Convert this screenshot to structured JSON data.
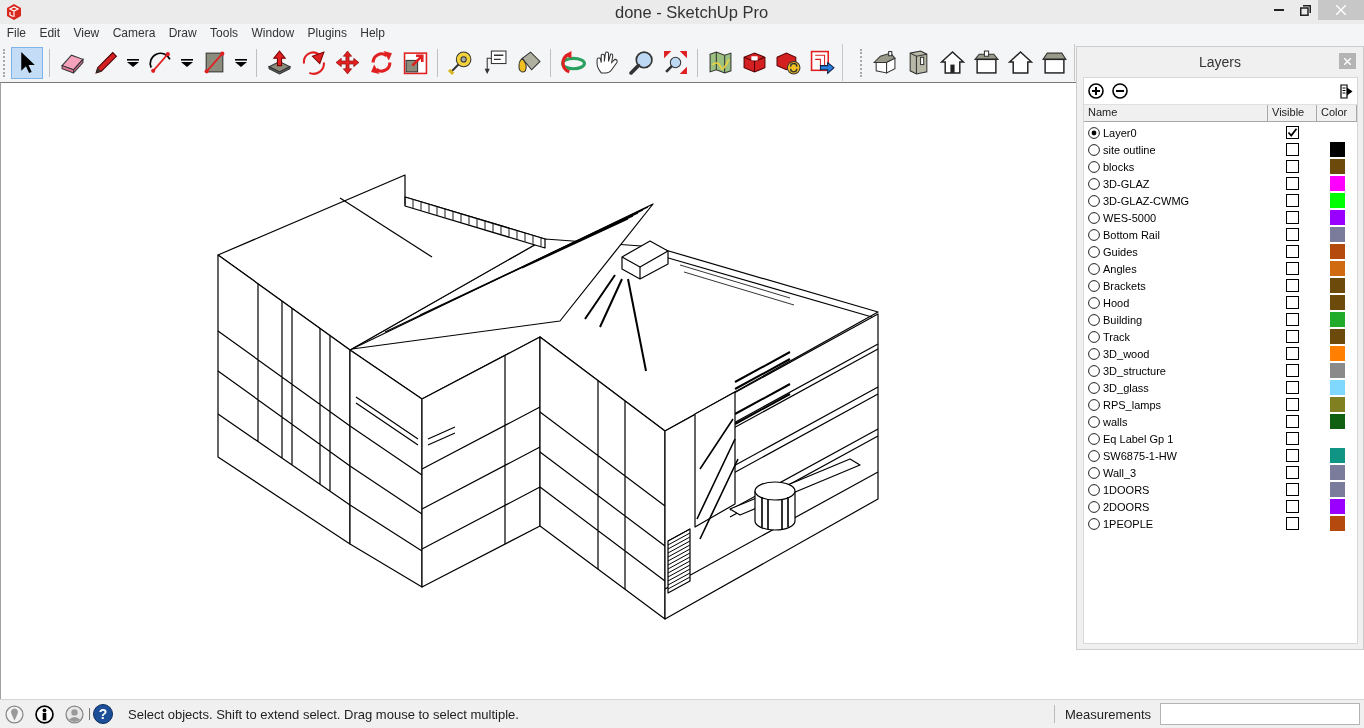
{
  "window": {
    "title": "done - SketchUp Pro"
  },
  "menu": [
    "File",
    "Edit",
    "View",
    "Camera",
    "Draw",
    "Tools",
    "Window",
    "Plugins",
    "Help"
  ],
  "toolbars": [
    {
      "groups": [
        [
          {
            "kind": "select",
            "selected": true,
            "dropdown": false
          }
        ],
        [
          {
            "kind": "eraser",
            "selected": false,
            "dropdown": false
          },
          {
            "kind": "pencil",
            "selected": false,
            "dropdown": true
          },
          {
            "kind": "arc",
            "selected": false,
            "dropdown": true
          },
          {
            "kind": "rectangle",
            "selected": false,
            "dropdown": true
          }
        ],
        [
          {
            "kind": "pushpull",
            "selected": false,
            "dropdown": false
          },
          {
            "kind": "followme",
            "selected": false,
            "dropdown": false
          },
          {
            "kind": "move",
            "selected": false,
            "dropdown": false
          },
          {
            "kind": "rotate",
            "selected": false,
            "dropdown": false
          },
          {
            "kind": "scale",
            "selected": false,
            "dropdown": false
          }
        ],
        [
          {
            "kind": "tape",
            "selected": false,
            "dropdown": false
          },
          {
            "kind": "text",
            "selected": false,
            "dropdown": false
          },
          {
            "kind": "paint",
            "selected": false,
            "dropdown": false
          }
        ],
        [
          {
            "kind": "orbit",
            "selected": false,
            "dropdown": false
          },
          {
            "kind": "pan",
            "selected": false,
            "dropdown": false
          },
          {
            "kind": "zoom",
            "selected": false,
            "dropdown": false
          },
          {
            "kind": "zoomext",
            "selected": false,
            "dropdown": false
          }
        ],
        [
          {
            "kind": "map",
            "selected": false,
            "dropdown": false
          },
          {
            "kind": "warehouse",
            "selected": false,
            "dropdown": false
          },
          {
            "kind": "share",
            "selected": false,
            "dropdown": false
          },
          {
            "kind": "export",
            "selected": false,
            "dropdown": false
          }
        ]
      ]
    },
    {
      "groups": [
        [
          {
            "kind": "iso",
            "selected": false,
            "dropdown": false
          },
          {
            "kind": "top",
            "selected": false,
            "dropdown": false
          },
          {
            "kind": "front",
            "selected": false,
            "dropdown": false
          },
          {
            "kind": "right",
            "selected": false,
            "dropdown": false
          },
          {
            "kind": "back",
            "selected": false,
            "dropdown": false
          },
          {
            "kind": "left",
            "selected": false,
            "dropdown": false
          }
        ]
      ]
    }
  ],
  "layers_panel": {
    "title": "Layers",
    "columns": [
      "Name",
      "Visible",
      "Color"
    ],
    "layers": [
      {
        "name": "Layer0",
        "selected": true,
        "visible": true
      },
      {
        "name": "site outline",
        "selected": false,
        "visible": false,
        "color": "#000000"
      },
      {
        "name": "blocks",
        "selected": false,
        "visible": false,
        "color": "#6b4a0c"
      },
      {
        "name": "3D-GLAZ",
        "selected": false,
        "visible": false,
        "color": "#ff00ff"
      },
      {
        "name": "3D-GLAZ-CWMG",
        "selected": false,
        "visible": false,
        "color": "#00ff00"
      },
      {
        "name": "WES-5000",
        "selected": false,
        "visible": false,
        "color": "#9900ff"
      },
      {
        "name": "Bottom Rail",
        "selected": false,
        "visible": false,
        "color": "#7b7b9c"
      },
      {
        "name": "Guides",
        "selected": false,
        "visible": false,
        "color": "#b54a0f"
      },
      {
        "name": "Angles",
        "selected": false,
        "visible": false,
        "color": "#d06a10"
      },
      {
        "name": "Brackets",
        "selected": false,
        "visible": false,
        "color": "#6b4a0c"
      },
      {
        "name": "Hood",
        "selected": false,
        "visible": false,
        "color": "#6b4a0c"
      },
      {
        "name": "Building",
        "selected": false,
        "visible": false,
        "color": "#22aa2a"
      },
      {
        "name": "Track",
        "selected": false,
        "visible": false,
        "color": "#6b4a0c"
      },
      {
        "name": "3D_wood",
        "selected": false,
        "visible": false,
        "color": "#ff8000"
      },
      {
        "name": "3D_structure",
        "selected": false,
        "visible": false,
        "color": "#8a8a8a"
      },
      {
        "name": "3D_glass",
        "selected": false,
        "visible": false,
        "color": "#80d8ff"
      },
      {
        "name": "RPS_lamps",
        "selected": false,
        "visible": false,
        "color": "#808020"
      },
      {
        "name": "walls",
        "selected": false,
        "visible": false,
        "color": "#116011"
      },
      {
        "name": "Eq Label Gp 1",
        "selected": false,
        "visible": false
      },
      {
        "name": "SW6875-1-HW",
        "selected": false,
        "visible": false,
        "color": "#109585"
      },
      {
        "name": "Wall_3",
        "selected": false,
        "visible": false,
        "color": "#7b7b9c"
      },
      {
        "name": "1DOORS",
        "selected": false,
        "visible": false,
        "color": "#7b7b9c"
      },
      {
        "name": "2DOORS",
        "selected": false,
        "visible": false,
        "color": "#9900ff"
      },
      {
        "name": "1PEOPLE",
        "selected": false,
        "visible": false,
        "color": "#b54a0f"
      }
    ]
  },
  "status_bar": {
    "help": "?",
    "message": "Select objects. Shift to extend select. Drag mouse to select multiple.",
    "measurements_label": "Measurements"
  }
}
